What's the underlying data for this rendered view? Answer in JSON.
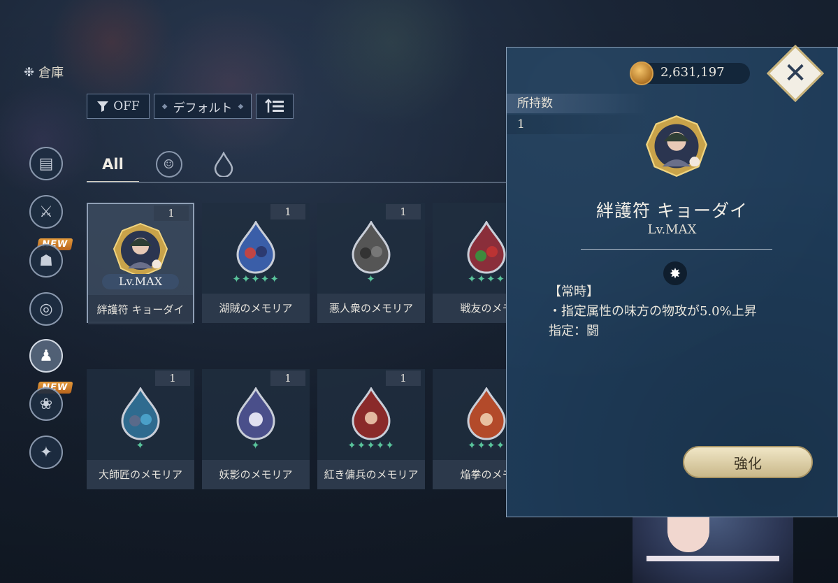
{
  "screen_title": "倉庫",
  "toolbar": {
    "filter_label": "OFF",
    "sort_label": "デフォルト"
  },
  "sidenav": {
    "items": [
      "chest",
      "sword",
      "armor",
      "ring",
      "memoria",
      "gift",
      "key"
    ],
    "new_badge": "NEW",
    "active_index": 4
  },
  "tabs": {
    "all_label": "All"
  },
  "cards": [
    {
      "count": "1",
      "level": "Lv.MAX",
      "name": "絆護符 キョーダイ",
      "stars": 0,
      "type": "emblem"
    },
    {
      "count": "1",
      "name": "湖賊のメモリア",
      "stars": 5,
      "color": "#3a5ea8"
    },
    {
      "count": "1",
      "name": "悪人衆のメモリア",
      "stars": 1,
      "color": "#555555"
    },
    {
      "count": "",
      "name": "戦友のメモ",
      "stars": 4,
      "color": "#8a2e3a"
    },
    {
      "count": "1",
      "name": "大師匠のメモリア",
      "stars": 1,
      "color": "#2f6b8f"
    },
    {
      "count": "1",
      "name": "妖影のメモリア",
      "stars": 1,
      "color": "#4a4f8a"
    },
    {
      "count": "1",
      "name": "紅き傭兵のメモリア",
      "stars": 5,
      "color": "#8a2a2a"
    },
    {
      "count": "",
      "name": "焔拳のメモ",
      "stars": 4,
      "color": "#b34a2a"
    }
  ],
  "panel": {
    "coins": "2,631,197",
    "owned_label": "所持数",
    "owned_value": "1",
    "item_name": "絆護符 キョーダイ",
    "item_level": "Lv.MAX",
    "desc_line1": "【常時】",
    "desc_line2": "・指定属性の味方の物攻が5.0%上昇",
    "desc_line3": "指定：闘",
    "enhance_label": "強化"
  },
  "colors": {
    "star": "#59c39b",
    "panel_bg": "#1e3b58",
    "enhance": "#e6dab4"
  }
}
